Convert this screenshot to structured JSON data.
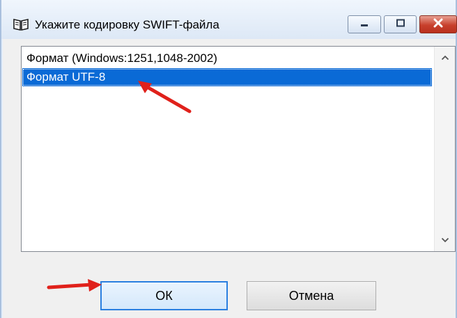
{
  "window": {
    "title": "Укажите кодировку SWIFT-файла",
    "icons": [
      "book-icon",
      "minimize-icon",
      "maximize-icon",
      "close-icon"
    ]
  },
  "list": {
    "items": [
      {
        "label": "Формат (Windows:1251,1048-2002)",
        "selected": false
      },
      {
        "label": "Формат UTF-8",
        "selected": true
      }
    ],
    "scrollbar_icons": [
      "chevron-up-icon",
      "chevron-down-icon"
    ]
  },
  "buttons": {
    "ok_label": "ОК",
    "cancel_label": "Отмена"
  },
  "colors": {
    "selection": "#0a6ad6",
    "annotation_arrow": "#e0211b",
    "default_button_border": "#2a7fe0"
  }
}
